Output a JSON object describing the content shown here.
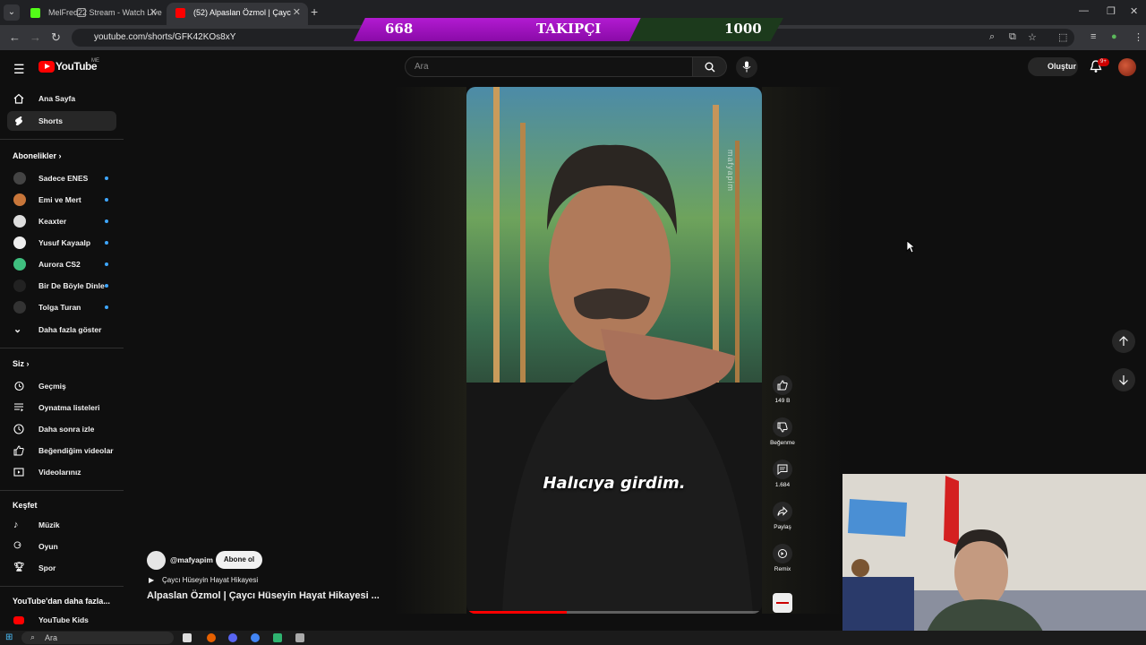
{
  "browser": {
    "tabs": [
      {
        "title": "MelFred22 Stream - Watch Live",
        "active": false
      },
      {
        "title": "(52) Alpaslan Özmol | Çayc",
        "active": true
      }
    ],
    "url": "youtube.com/shorts/GFK42KOs8xY"
  },
  "overlay": {
    "current": "668",
    "label": "TAKIPÇI",
    "goal": "1000",
    "progress_fraction": 0.668
  },
  "youtube": {
    "logo": "YouTube",
    "country": "ME",
    "search_placeholder": "Ara",
    "create_label": "Oluştur",
    "notif_count": "9+"
  },
  "sidebar": {
    "main": [
      {
        "label": "Ana Sayfa",
        "icon": "home-icon",
        "active": false
      },
      {
        "label": "Shorts",
        "icon": "shorts-icon",
        "active": true
      }
    ],
    "subs_heading": "Abonelikler",
    "subscriptions": [
      {
        "label": "Sadece ENES",
        "color": "#444444"
      },
      {
        "label": "Emi ve Mert",
        "color": "#c8763a"
      },
      {
        "label": "Keaxter",
        "color": "#dddddd"
      },
      {
        "label": "Yusuf Kayaalp",
        "color": "#eeeeee"
      },
      {
        "label": "Aurora CS2",
        "color": "#3fbf7f"
      },
      {
        "label": "Bir De Böyle Dinle",
        "color": "#222222"
      },
      {
        "label": "Tolga Turan",
        "color": "#333333"
      }
    ],
    "show_more": "Daha fazla göster",
    "you_heading": "Siz",
    "you_items": [
      {
        "label": "Geçmiş",
        "icon": "history-icon"
      },
      {
        "label": "Oynatma listeleri",
        "icon": "playlists-icon"
      },
      {
        "label": "Daha sonra izle",
        "icon": "watch-later-icon"
      },
      {
        "label": "Beğendiğim videolar",
        "icon": "liked-icon"
      },
      {
        "label": "Videolarınız",
        "icon": "your-videos-icon"
      }
    ],
    "explore_heading": "Keşfet",
    "explore_items": [
      {
        "label": "Müzik",
        "icon": "music-icon"
      },
      {
        "label": "Oyun",
        "icon": "gaming-icon"
      },
      {
        "label": "Spor",
        "icon": "trophy-icon"
      }
    ],
    "more_heading": "YouTube'dan daha fazla...",
    "more_items": [
      {
        "label": "YouTube Kids"
      }
    ]
  },
  "short": {
    "caption": "Halıcıya girdim.",
    "watermark": "mafyapim",
    "progress": 0.34,
    "channel": "@mafyapim",
    "subscribe_label": "Abone ol",
    "playlist": "Çaycı Hüseyin Hayat Hikayesi",
    "title": "Alpaslan Özmol | Çaycı Hüseyin Hayat Hikayesi ...",
    "actions": {
      "likes": "149 B",
      "dislike": "Beğenme",
      "comments": "1.684",
      "share": "Paylaş",
      "remix": "Remix"
    }
  },
  "taskbar": {
    "search": "Ara"
  }
}
